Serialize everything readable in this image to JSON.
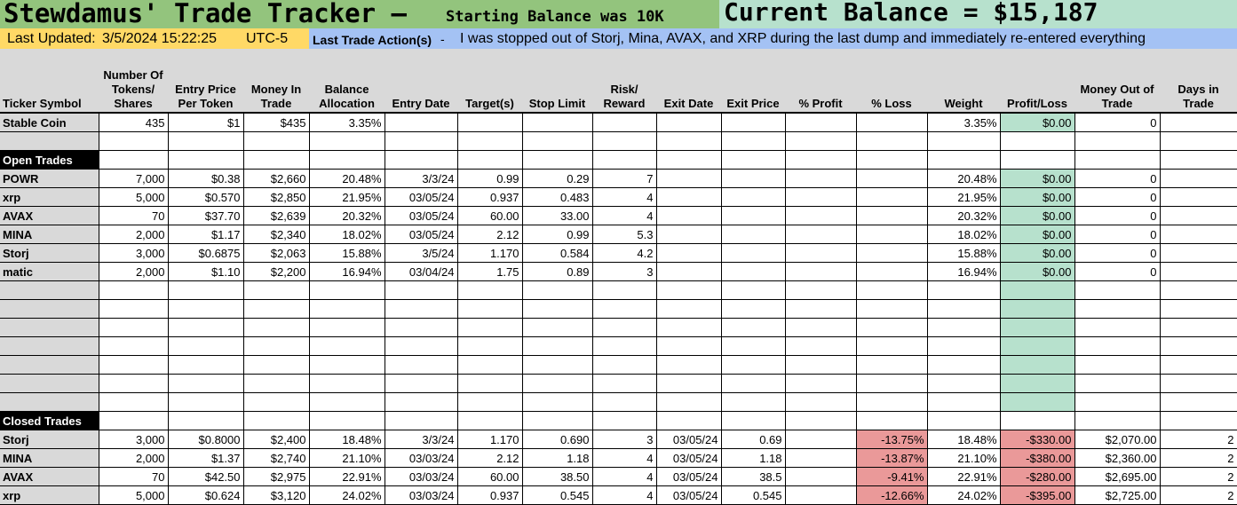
{
  "header": {
    "title": "Stewdamus' Trade Tracker –",
    "subtitle": "Starting Balance was 10K",
    "balance": "Current Balance = $15,187"
  },
  "status": {
    "updated_label": "Last Updated:",
    "updated_date": "3/5/2024 15:22:25",
    "timezone": "UTC-5",
    "action_label": "Last Trade Action(s)",
    "action_sep": "-",
    "action_text": "I was stopped out of Storj, Mina, AVAX, and XRP during the last dump and immediately re-entered everything"
  },
  "columns": [
    "Ticker Symbol",
    "Number Of Tokens/ Shares",
    "Entry Price Per Token",
    "Money In Trade",
    "Balance Allocation",
    "Entry Date",
    "Target(s)",
    "Stop Limit",
    "Risk/ Reward",
    "Exit Date",
    "Exit Price",
    "% Profit",
    "% Loss",
    "Weight",
    "Profit/Loss",
    "Money Out of Trade",
    "Days in Trade"
  ],
  "stable": {
    "label": "Stable Coin",
    "row": [
      "435",
      "$1",
      "$435",
      "3.35%",
      "",
      "",
      "",
      "",
      "",
      "",
      "",
      "",
      "3.35%",
      "$0.00",
      "0",
      ""
    ]
  },
  "open_trades": {
    "label": "Open Trades",
    "rows": [
      {
        "ticker": "POWR",
        "cells": [
          "7,000",
          "$0.38",
          "$2,660",
          "20.48%",
          "3/3/24",
          "0.99",
          "0.29",
          "7",
          "",
          "",
          "",
          "",
          "20.48%",
          "$0.00",
          "0",
          ""
        ]
      },
      {
        "ticker": "xrp",
        "cells": [
          "5,000",
          "$0.570",
          "$2,850",
          "21.95%",
          "03/05/24",
          "0.937",
          "0.483",
          "4",
          "",
          "",
          "",
          "",
          "21.95%",
          "$0.00",
          "0",
          ""
        ]
      },
      {
        "ticker": "AVAX",
        "cells": [
          "70",
          "$37.70",
          "$2,639",
          "20.32%",
          "03/05/24",
          "60.00",
          "33.00",
          "4",
          "",
          "",
          "",
          "",
          "20.32%",
          "$0.00",
          "0",
          ""
        ]
      },
      {
        "ticker": "MINA",
        "cells": [
          "2,000",
          "$1.17",
          "$2,340",
          "18.02%",
          "03/05/24",
          "2.12",
          "0.99",
          "5.3",
          "",
          "",
          "",
          "",
          "18.02%",
          "$0.00",
          "0",
          ""
        ]
      },
      {
        "ticker": "Storj",
        "cells": [
          "3,000",
          "$0.6875",
          "$2,063",
          "15.88%",
          "3/5/24",
          "1.170",
          "0.584",
          "4.2",
          "",
          "",
          "",
          "",
          "15.88%",
          "$0.00",
          "0",
          ""
        ]
      },
      {
        "ticker": "matic",
        "cells": [
          "2,000",
          "$1.10",
          "$2,200",
          "16.94%",
          "03/04/24",
          "1.75",
          "0.89",
          "3",
          "",
          "",
          "",
          "",
          "16.94%",
          "$0.00",
          "0",
          ""
        ]
      }
    ]
  },
  "closed_trades": {
    "label": "Closed Trades",
    "rows": [
      {
        "ticker": "Storj",
        "cells": [
          "3,000",
          "$0.8000",
          "$2,400",
          "18.48%",
          "3/3/24",
          "1.170",
          "0.690",
          "3",
          "03/05/24",
          "0.69",
          "",
          "-13.75%",
          "18.48%",
          "-$330.00",
          "$2,070.00",
          "2"
        ]
      },
      {
        "ticker": "MINA",
        "cells": [
          "2,000",
          "$1.37",
          "$2,740",
          "21.10%",
          "03/03/24",
          "2.12",
          "1.18",
          "4",
          "03/05/24",
          "1.18",
          "",
          "-13.87%",
          "21.10%",
          "-$380.00",
          "$2,360.00",
          "2"
        ]
      },
      {
        "ticker": "AVAX",
        "cells": [
          "70",
          "$42.50",
          "$2,975",
          "22.91%",
          "03/03/24",
          "60.00",
          "38.50",
          "4",
          "03/05/24",
          "38.5",
          "",
          "-9.41%",
          "22.91%",
          "-$280.00",
          "$2,695.00",
          "2"
        ]
      },
      {
        "ticker": "xrp",
        "cells": [
          "5,000",
          "$0.624",
          "$3,120",
          "24.02%",
          "03/03/24",
          "0.937",
          "0.545",
          "4",
          "03/05/24",
          "0.545",
          "",
          "-12.66%",
          "24.02%",
          "-$395.00",
          "$2,725.00",
          "2"
        ]
      }
    ]
  },
  "colors": {
    "title_bg": "#93c47d",
    "balance_bg": "#b7e1cd",
    "updated_bg": "#ffd966",
    "action_bg": "#a4c2f4",
    "profit_cell": "#b7e1cd",
    "loss_cell": "#ea9999",
    "header_bg": "#d9d9d9"
  }
}
